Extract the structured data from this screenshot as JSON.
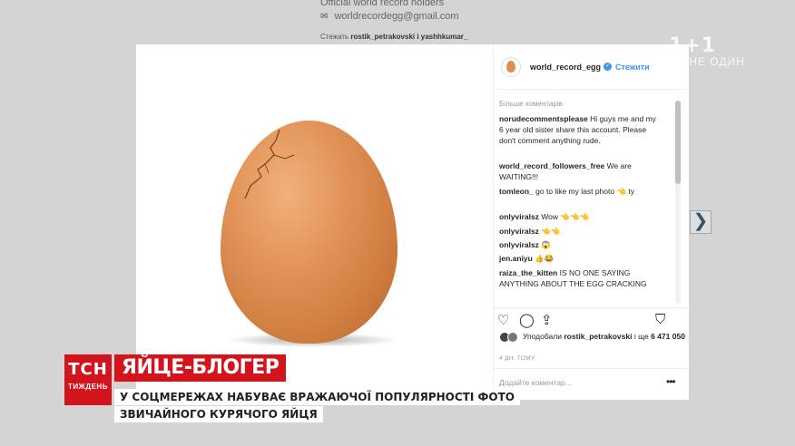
{
  "background": {
    "bio_line": "Official world record holders",
    "email": "worldrecordegg@gmail.com",
    "followed_by_label": "Стежать",
    "followed_by_names": "rostik_petrakovski і yashhkumar_"
  },
  "channel": {
    "number": "1+1",
    "slogan": "ТИ НЕ ОДИН"
  },
  "post": {
    "username": "world_record_egg",
    "follow_label": "Стежити",
    "verified_glyph": "✓",
    "more_comments_label": "Більше коментарів",
    "comments": [
      {
        "user": "norudecommentsplease",
        "text": "Hi guys me and my 6 year old sister share this account. Please don't comment anything rude."
      },
      {
        "user": "world_record_followers_free",
        "text": "We are WAITING!!!"
      },
      {
        "user": "tomleon_",
        "text": "go to like my last photo 👈 ty"
      },
      {
        "user": "onlyviralsz",
        "text": "Wow 👈👈👈"
      },
      {
        "user": "onlyviralsz",
        "text": "👈👈"
      },
      {
        "user": "onlyviralsz",
        "text": "😱"
      },
      {
        "user": "jen.aniyu",
        "text": "👍😂"
      },
      {
        "user": "raiza_the_kitten",
        "text": "IS NO ONE SAYING ANYTHING ABOUT THE EGG CRACKING"
      }
    ],
    "heart_glyph": "♡",
    "likes_prefix": "Уподобали",
    "likes_user": "rostik_petrakovski",
    "likes_middle": "і ще",
    "likes_count": "6 471 050",
    "time_ago": "4 ДН. ТОМУ",
    "add_comment_placeholder": "Додайте коментар...",
    "more_glyph": "•••"
  },
  "icons": {
    "like": "♡",
    "comment": "◯",
    "share": "⇪",
    "save": "⛉",
    "next": "❯",
    "email": "✉"
  },
  "tv": {
    "logo": "ТСН",
    "logo_sub": "ТИЖДЕНЬ",
    "headline": "ЯЙЦЕ-БЛОГЕР",
    "subtitle_1": "У СОЦМЕРЕЖАХ НАБУВАЄ ВРАЖАЮЧОЇ ПОПУЛЯРНОСТІ ФОТО",
    "subtitle_2": "ЗВИЧАЙНОГО КУРЯЧОГО ЯЙЦЯ"
  },
  "colors": {
    "accent_blue": "#3897f0",
    "tv_red": "#d4141c"
  }
}
